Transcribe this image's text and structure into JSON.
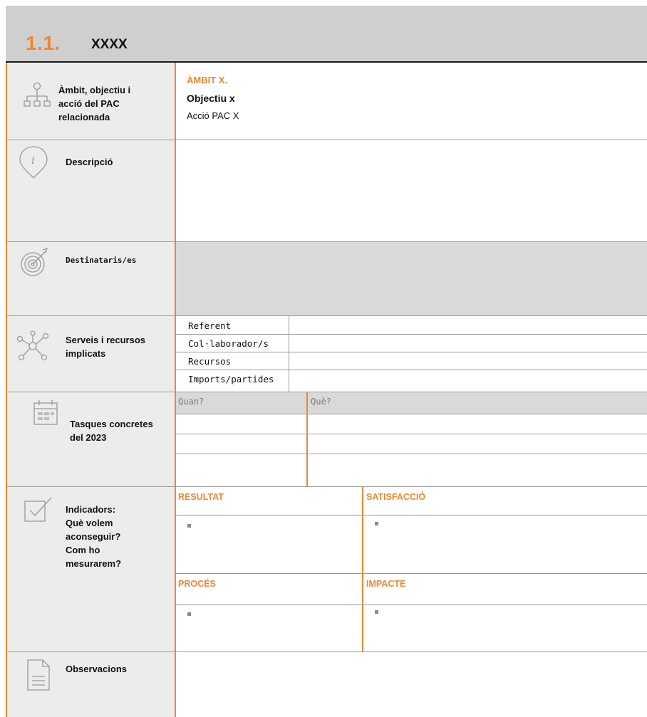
{
  "header": {
    "number": "1.1.",
    "title": "XXXX"
  },
  "rows": {
    "ambit": {
      "label_lines": [
        "Àmbit, objectiu i",
        "acció del PAC",
        "relacionada"
      ],
      "ambit_value": "ÀMBIT X.",
      "objectiu_value": "Objectiu x",
      "accio_value": "Acció PAC X"
    },
    "descripcio": {
      "label": "Descripció"
    },
    "destinataris": {
      "label": "Destinataris/es"
    },
    "serveis": {
      "label_lines": [
        "Serveis i recursos",
        "implicats"
      ],
      "items": [
        "Referent",
        "Col·laborador/s",
        "Recursos",
        "Imports/partides"
      ]
    },
    "tasques": {
      "label_lines": [
        "Tasques concretes",
        "del 2023"
      ],
      "col_quan": "Quan?",
      "col_que": "Què?"
    },
    "indicadors": {
      "label_lines": [
        "Indicadors:",
        "Què volem",
        "aconseguir?",
        "Com ho",
        "mesurarem?"
      ],
      "resultat": "RESULTAT",
      "satisfaccio": "SATISFACCIÓ",
      "proces": "PROCÉS",
      "impacte": "IMPACTE"
    },
    "observacions": {
      "label": "Observacions"
    }
  },
  "icons": {
    "ambit": "hierarchy-icon",
    "descripcio": "info-pin-icon",
    "destinataris": "target-icon",
    "serveis": "network-icon",
    "tasques": "calendar-icon",
    "indicadors": "checkbox-icon",
    "observacions": "document-icon"
  },
  "colors": {
    "accent": "#ee8732",
    "header_bg": "#cfcfcf",
    "label_bg": "#ececec",
    "shaded": "#d9d9d9"
  }
}
